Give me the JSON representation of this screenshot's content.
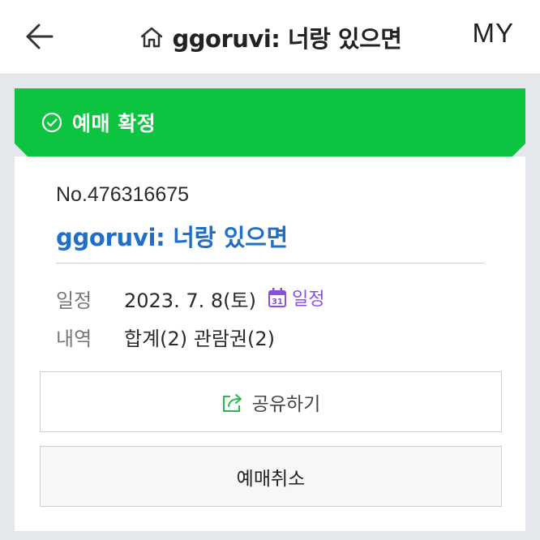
{
  "header": {
    "title": "ggoruvi: 너랑 있으면",
    "my_label": "MY"
  },
  "status": {
    "text": "예매 확정",
    "color": "#0cc43f"
  },
  "booking": {
    "number": "No.476316675",
    "show_name": "ggoruvi: 너랑 있으면",
    "schedule_label": "일정",
    "schedule_value": "2023. 7. 8(토)",
    "calendar_link": "일정",
    "calendar_day": "31",
    "details_label": "내역",
    "details_value": "합계(2) 관람권(2)"
  },
  "actions": {
    "share_label": "공유하기",
    "cancel_label": "예매취소"
  },
  "colors": {
    "link_blue": "#1f6fc8",
    "calendar_purple": "#8a4fe0",
    "share_green": "#2fb84a"
  }
}
